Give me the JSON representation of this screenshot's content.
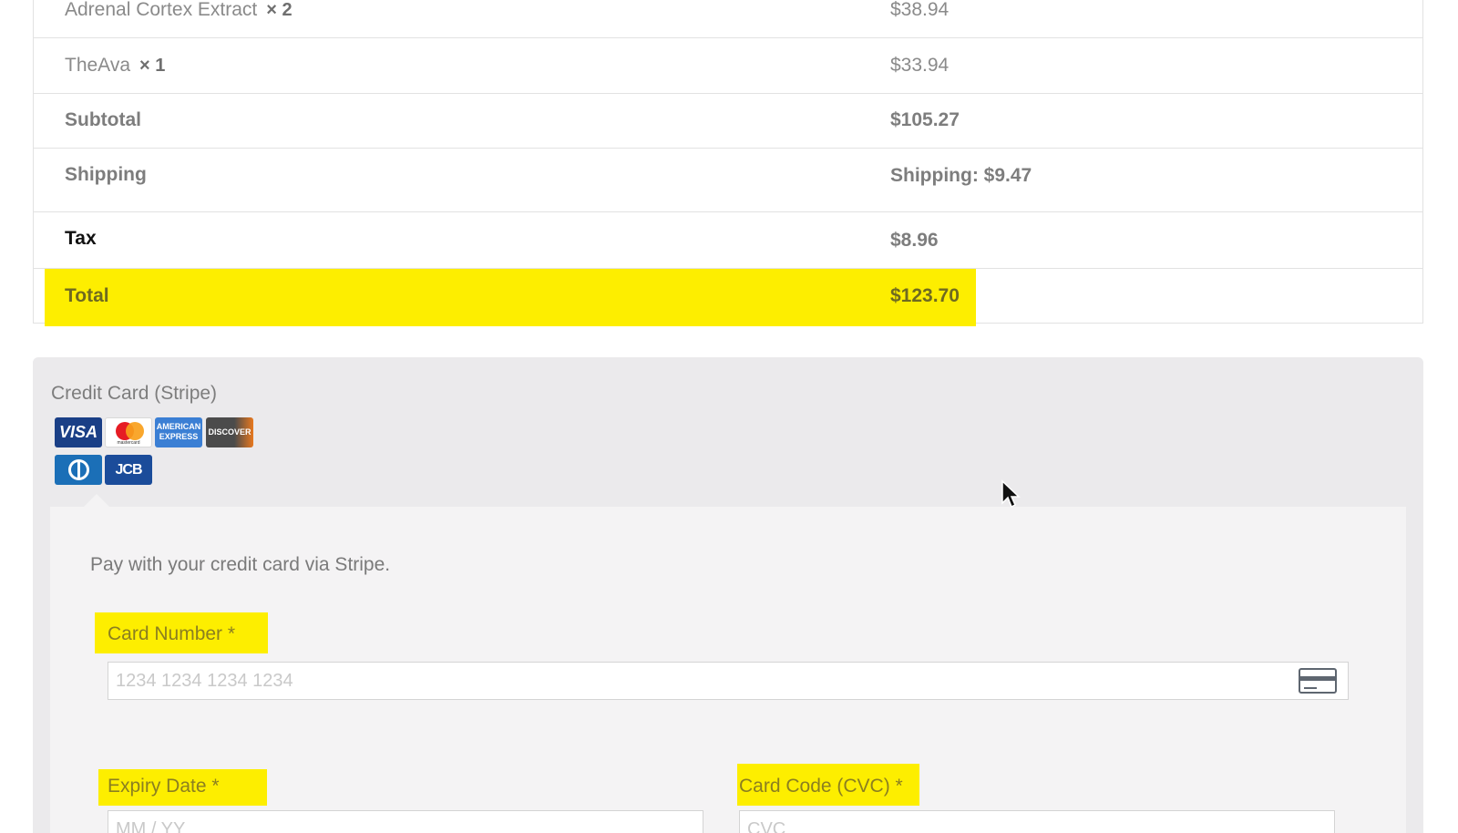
{
  "order": {
    "items": [
      {
        "name": "Adrenal Cortex Extract",
        "qty": "× 2",
        "price": "$38.94"
      },
      {
        "name": "TheAva",
        "qty": "× 1",
        "price": "$33.94"
      }
    ],
    "subtotal": {
      "label": "Subtotal",
      "value": "$105.27"
    },
    "shipping": {
      "label": "Shipping",
      "value": "Shipping: $9.47"
    },
    "tax": {
      "label": "Tax",
      "value": "$8.96"
    },
    "total": {
      "label": "Total",
      "value": "$123.70"
    }
  },
  "payment": {
    "method_title": "Credit Card (Stripe)",
    "card_brands": [
      {
        "name": "visa-logo-icon",
        "text": "VISA"
      },
      {
        "name": "mastercard-logo-icon",
        "text": "mastercard"
      },
      {
        "name": "amex-logo-icon",
        "text": "AMERICAN EXPRESS"
      },
      {
        "name": "discover-logo-icon",
        "text": "DISCOVER"
      },
      {
        "name": "diners-club-logo-icon",
        "text": ""
      },
      {
        "name": "jcb-logo-icon",
        "text": "JCB"
      }
    ],
    "description": "Pay with your credit card via Stripe.",
    "card_number": {
      "label": "Card Number *",
      "placeholder": "1234 1234 1234 1234",
      "value": ""
    },
    "expiry": {
      "label": "Expiry Date *",
      "placeholder": "MM / YY",
      "value": ""
    },
    "cvc": {
      "label": "Card Code (CVC) *",
      "placeholder": "CVC",
      "value": ""
    }
  },
  "colors": {
    "highlight": "#fdee00",
    "panel_bg": "#ebeaec",
    "inner_panel_bg": "#f4f3f4",
    "text_muted": "#7a7a7a"
  }
}
